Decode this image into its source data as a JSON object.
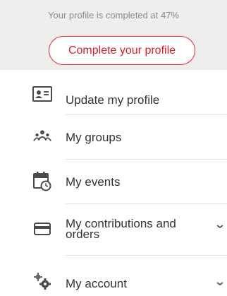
{
  "profile": {
    "completion_text": "Your profile is completed at 47%",
    "completion_percent": 47,
    "cta_label": "Complete your profile",
    "accent_color": "#e8222f"
  },
  "menu": {
    "items": [
      {
        "label": "Update my profile",
        "icon": "id-card-icon"
      },
      {
        "label": "My groups",
        "icon": "group-people-icon"
      },
      {
        "label": "My events",
        "icon": "calendar-clock-icon"
      },
      {
        "label_line1": "My contributions and",
        "label_line2": "orders",
        "icon": "credit-card-icon",
        "has_chevron": true
      },
      {
        "label": "My account",
        "icon": "gears-icon",
        "has_chevron": true
      }
    ]
  }
}
